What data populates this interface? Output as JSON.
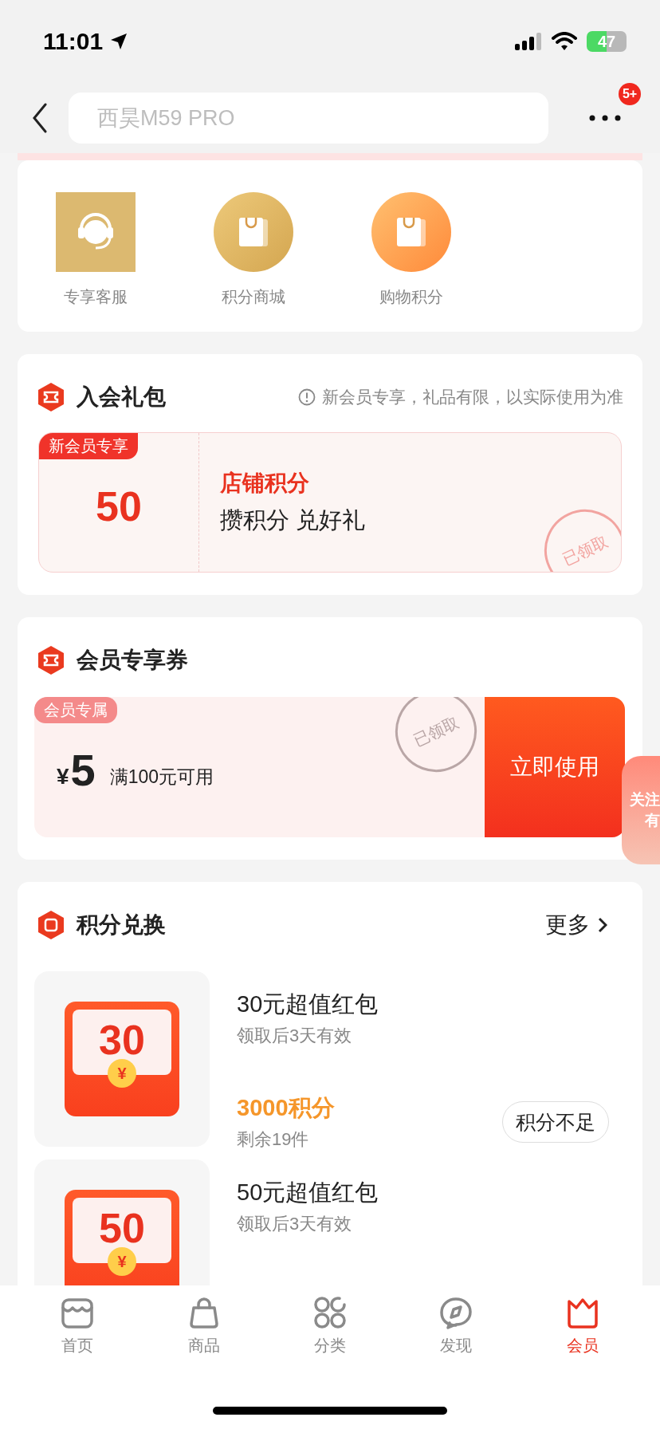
{
  "status_bar": {
    "time": "11:01",
    "battery": "47"
  },
  "header": {
    "search_placeholder": "西昊M59 PRO",
    "badge": "5+"
  },
  "services": [
    {
      "label": "专享客服",
      "kind": "headset"
    },
    {
      "label": "积分商城",
      "kind": "bag-gold"
    },
    {
      "label": "购物积分",
      "kind": "bag-orange"
    }
  ],
  "gift": {
    "title": "入会礼包",
    "notice": "新会员专享，礼品有限，以实际使用为准",
    "tag": "新会员专享",
    "amount": "50",
    "name": "店铺积分",
    "slogan": "攒积分 兑好礼",
    "stamp": "已领取"
  },
  "coupon": {
    "title": "会员专享券",
    "tag": "会员专属",
    "currency": "¥",
    "amount": "5",
    "condition": "满100元可用",
    "stamp": "已领取",
    "action": "立即使用"
  },
  "exchange": {
    "title": "积分兑换",
    "more": "更多",
    "items": [
      {
        "amount": "30",
        "coin": "¥",
        "name": "30元超值红包",
        "validity": "领取后3天有效",
        "price": "3000积分",
        "stock": "剩余19件",
        "action": "积分不足"
      },
      {
        "amount": "50",
        "coin": "¥",
        "name": "50元超值红包",
        "validity": "领取后3天有效"
      }
    ]
  },
  "float_widget": {
    "line_1": "关注",
    "line_2": "有"
  },
  "tabs": [
    {
      "label": "首页",
      "kind": "store",
      "selected": false
    },
    {
      "label": "商品",
      "kind": "bag",
      "selected": false
    },
    {
      "label": "分类",
      "kind": "grid",
      "selected": false
    },
    {
      "label": "发现",
      "kind": "compass",
      "selected": false
    },
    {
      "label": "会员",
      "kind": "crown",
      "selected": true
    }
  ]
}
